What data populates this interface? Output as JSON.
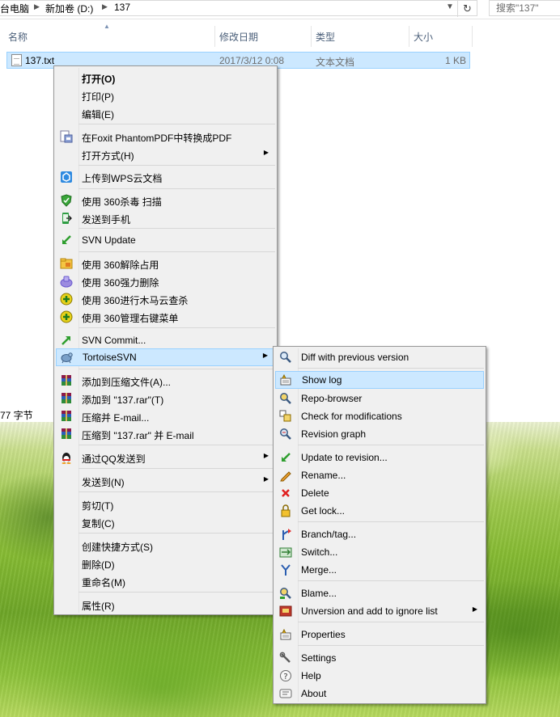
{
  "explorer": {
    "breadcrumbs": [
      "台电脑",
      "新加卷 (D:)",
      "137"
    ],
    "search_placeholder": "搜索\"137\"",
    "columns": {
      "name": "名称",
      "modified": "修改日期",
      "type": "类型",
      "size": "大小"
    },
    "file": {
      "name": "137.txt",
      "modified": "2017/3/12 0:08",
      "type": "文本文档",
      "size": "1 KB"
    },
    "status": "77 字节"
  },
  "context_menu": {
    "items": [
      {
        "label": "打开(O)",
        "bold": true
      },
      {
        "label": "打印(P)"
      },
      {
        "label": "编辑(E)"
      },
      {
        "label": "在Foxit PhantomPDF中转换成PDF",
        "icon": "foxit-pdf-icon"
      },
      {
        "label": "打开方式(H)",
        "submenu": true
      },
      {
        "label": "上传到WPS云文档",
        "icon": "wps-cloud-icon"
      },
      {
        "label": "使用 360杀毒 扫描",
        "icon": "360-antivirus-shield-icon"
      },
      {
        "label": "发送到手机",
        "icon": "send-to-phone-icon"
      },
      {
        "label": "SVN Update",
        "icon": "svn-update-icon"
      },
      {
        "label": "使用 360解除占用",
        "icon": "360-unlock-icon"
      },
      {
        "label": "使用 360强力删除",
        "icon": "360-force-delete-icon"
      },
      {
        "label": "使用 360进行木马云查杀",
        "icon": "360-trojan-scan-icon"
      },
      {
        "label": "使用 360管理右键菜单",
        "icon": "360-menu-manager-icon"
      },
      {
        "label": "SVN Commit...",
        "icon": "svn-commit-icon"
      },
      {
        "label": "TortoiseSVN",
        "icon": "tortoisesvn-turtle-icon",
        "submenu": true,
        "highlighted": true
      },
      {
        "label": "添加到压缩文件(A)...",
        "icon": "winrar-archive-icon"
      },
      {
        "label": "添加到 \"137.rar\"(T)",
        "icon": "winrar-archive-icon"
      },
      {
        "label": "压缩并 E-mail...",
        "icon": "winrar-archive-icon"
      },
      {
        "label": "压缩到 \"137.rar\" 并 E-mail",
        "icon": "winrar-archive-icon"
      },
      {
        "label": "通过QQ发送到",
        "icon": "qq-penguin-icon",
        "submenu": true
      },
      {
        "label": "发送到(N)",
        "submenu": true
      },
      {
        "label": "剪切(T)"
      },
      {
        "label": "复制(C)"
      },
      {
        "label": "创建快捷方式(S)"
      },
      {
        "label": "删除(D)"
      },
      {
        "label": "重命名(M)"
      },
      {
        "label": "属性(R)"
      }
    ]
  },
  "svn_menu": {
    "items": [
      {
        "label": "Diff with previous version",
        "icon": "diff-magnifier-icon"
      },
      {
        "label": "Show log",
        "icon": "show-log-icon",
        "highlighted": true
      },
      {
        "label": "Repo-browser",
        "icon": "repo-browser-icon"
      },
      {
        "label": "Check for modifications",
        "icon": "check-modifications-icon"
      },
      {
        "label": "Revision graph",
        "icon": "revision-graph-icon"
      },
      {
        "label": "Update to revision...",
        "icon": "update-to-revision-icon"
      },
      {
        "label": "Rename...",
        "icon": "rename-pencil-icon"
      },
      {
        "label": "Delete",
        "icon": "delete-x-icon"
      },
      {
        "label": "Get lock...",
        "icon": "lock-icon"
      },
      {
        "label": "Branch/tag...",
        "icon": "branch-tag-icon"
      },
      {
        "label": "Switch...",
        "icon": "switch-icon"
      },
      {
        "label": "Merge...",
        "icon": "merge-icon"
      },
      {
        "label": "Blame...",
        "icon": "blame-icon"
      },
      {
        "label": "Unversion and add to ignore list",
        "icon": "ignore-list-icon",
        "submenu": true
      },
      {
        "label": "Properties",
        "icon": "properties-icon"
      },
      {
        "label": "Settings",
        "icon": "settings-wrench-icon"
      },
      {
        "label": "Help",
        "icon": "help-icon"
      },
      {
        "label": "About",
        "icon": "about-icon"
      }
    ]
  },
  "colors": {
    "selection_fill": "#cce8ff",
    "selection_border": "#99d1ff",
    "menu_background": "#f0f0f0",
    "column_header_text": "#4c607a"
  }
}
